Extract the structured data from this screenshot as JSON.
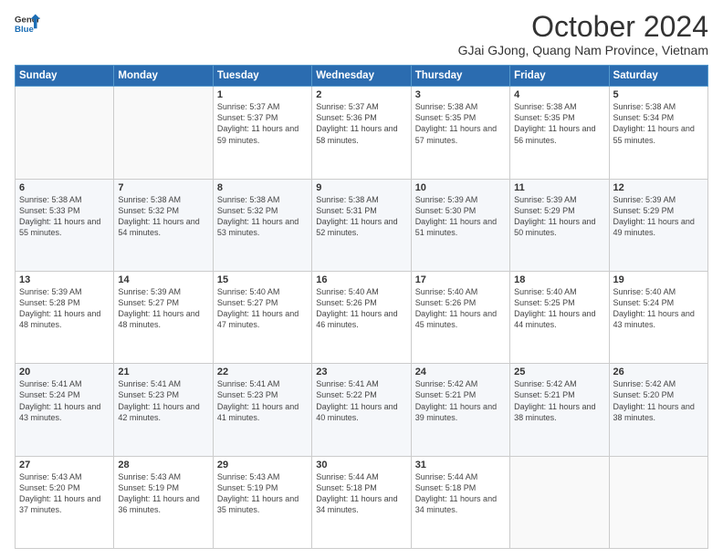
{
  "header": {
    "logo": {
      "line1": "General",
      "line2": "Blue"
    },
    "title": "October 2024",
    "subtitle": "GJai GJong, Quang Nam Province, Vietnam"
  },
  "weekdays": [
    "Sunday",
    "Monday",
    "Tuesday",
    "Wednesday",
    "Thursday",
    "Friday",
    "Saturday"
  ],
  "weeks": [
    [
      {
        "day": "",
        "sunrise": "",
        "sunset": "",
        "daylight": ""
      },
      {
        "day": "",
        "sunrise": "",
        "sunset": "",
        "daylight": ""
      },
      {
        "day": "1",
        "sunrise": "Sunrise: 5:37 AM",
        "sunset": "Sunset: 5:37 PM",
        "daylight": "Daylight: 11 hours and 59 minutes."
      },
      {
        "day": "2",
        "sunrise": "Sunrise: 5:37 AM",
        "sunset": "Sunset: 5:36 PM",
        "daylight": "Daylight: 11 hours and 58 minutes."
      },
      {
        "day": "3",
        "sunrise": "Sunrise: 5:38 AM",
        "sunset": "Sunset: 5:35 PM",
        "daylight": "Daylight: 11 hours and 57 minutes."
      },
      {
        "day": "4",
        "sunrise": "Sunrise: 5:38 AM",
        "sunset": "Sunset: 5:35 PM",
        "daylight": "Daylight: 11 hours and 56 minutes."
      },
      {
        "day": "5",
        "sunrise": "Sunrise: 5:38 AM",
        "sunset": "Sunset: 5:34 PM",
        "daylight": "Daylight: 11 hours and 55 minutes."
      }
    ],
    [
      {
        "day": "6",
        "sunrise": "Sunrise: 5:38 AM",
        "sunset": "Sunset: 5:33 PM",
        "daylight": "Daylight: 11 hours and 55 minutes."
      },
      {
        "day": "7",
        "sunrise": "Sunrise: 5:38 AM",
        "sunset": "Sunset: 5:32 PM",
        "daylight": "Daylight: 11 hours and 54 minutes."
      },
      {
        "day": "8",
        "sunrise": "Sunrise: 5:38 AM",
        "sunset": "Sunset: 5:32 PM",
        "daylight": "Daylight: 11 hours and 53 minutes."
      },
      {
        "day": "9",
        "sunrise": "Sunrise: 5:38 AM",
        "sunset": "Sunset: 5:31 PM",
        "daylight": "Daylight: 11 hours and 52 minutes."
      },
      {
        "day": "10",
        "sunrise": "Sunrise: 5:39 AM",
        "sunset": "Sunset: 5:30 PM",
        "daylight": "Daylight: 11 hours and 51 minutes."
      },
      {
        "day": "11",
        "sunrise": "Sunrise: 5:39 AM",
        "sunset": "Sunset: 5:29 PM",
        "daylight": "Daylight: 11 hours and 50 minutes."
      },
      {
        "day": "12",
        "sunrise": "Sunrise: 5:39 AM",
        "sunset": "Sunset: 5:29 PM",
        "daylight": "Daylight: 11 hours and 49 minutes."
      }
    ],
    [
      {
        "day": "13",
        "sunrise": "Sunrise: 5:39 AM",
        "sunset": "Sunset: 5:28 PM",
        "daylight": "Daylight: 11 hours and 48 minutes."
      },
      {
        "day": "14",
        "sunrise": "Sunrise: 5:39 AM",
        "sunset": "Sunset: 5:27 PM",
        "daylight": "Daylight: 11 hours and 48 minutes."
      },
      {
        "day": "15",
        "sunrise": "Sunrise: 5:40 AM",
        "sunset": "Sunset: 5:27 PM",
        "daylight": "Daylight: 11 hours and 47 minutes."
      },
      {
        "day": "16",
        "sunrise": "Sunrise: 5:40 AM",
        "sunset": "Sunset: 5:26 PM",
        "daylight": "Daylight: 11 hours and 46 minutes."
      },
      {
        "day": "17",
        "sunrise": "Sunrise: 5:40 AM",
        "sunset": "Sunset: 5:26 PM",
        "daylight": "Daylight: 11 hours and 45 minutes."
      },
      {
        "day": "18",
        "sunrise": "Sunrise: 5:40 AM",
        "sunset": "Sunset: 5:25 PM",
        "daylight": "Daylight: 11 hours and 44 minutes."
      },
      {
        "day": "19",
        "sunrise": "Sunrise: 5:40 AM",
        "sunset": "Sunset: 5:24 PM",
        "daylight": "Daylight: 11 hours and 43 minutes."
      }
    ],
    [
      {
        "day": "20",
        "sunrise": "Sunrise: 5:41 AM",
        "sunset": "Sunset: 5:24 PM",
        "daylight": "Daylight: 11 hours and 43 minutes."
      },
      {
        "day": "21",
        "sunrise": "Sunrise: 5:41 AM",
        "sunset": "Sunset: 5:23 PM",
        "daylight": "Daylight: 11 hours and 42 minutes."
      },
      {
        "day": "22",
        "sunrise": "Sunrise: 5:41 AM",
        "sunset": "Sunset: 5:23 PM",
        "daylight": "Daylight: 11 hours and 41 minutes."
      },
      {
        "day": "23",
        "sunrise": "Sunrise: 5:41 AM",
        "sunset": "Sunset: 5:22 PM",
        "daylight": "Daylight: 11 hours and 40 minutes."
      },
      {
        "day": "24",
        "sunrise": "Sunrise: 5:42 AM",
        "sunset": "Sunset: 5:21 PM",
        "daylight": "Daylight: 11 hours and 39 minutes."
      },
      {
        "day": "25",
        "sunrise": "Sunrise: 5:42 AM",
        "sunset": "Sunset: 5:21 PM",
        "daylight": "Daylight: 11 hours and 38 minutes."
      },
      {
        "day": "26",
        "sunrise": "Sunrise: 5:42 AM",
        "sunset": "Sunset: 5:20 PM",
        "daylight": "Daylight: 11 hours and 38 minutes."
      }
    ],
    [
      {
        "day": "27",
        "sunrise": "Sunrise: 5:43 AM",
        "sunset": "Sunset: 5:20 PM",
        "daylight": "Daylight: 11 hours and 37 minutes."
      },
      {
        "day": "28",
        "sunrise": "Sunrise: 5:43 AM",
        "sunset": "Sunset: 5:19 PM",
        "daylight": "Daylight: 11 hours and 36 minutes."
      },
      {
        "day": "29",
        "sunrise": "Sunrise: 5:43 AM",
        "sunset": "Sunset: 5:19 PM",
        "daylight": "Daylight: 11 hours and 35 minutes."
      },
      {
        "day": "30",
        "sunrise": "Sunrise: 5:44 AM",
        "sunset": "Sunset: 5:18 PM",
        "daylight": "Daylight: 11 hours and 34 minutes."
      },
      {
        "day": "31",
        "sunrise": "Sunrise: 5:44 AM",
        "sunset": "Sunset: 5:18 PM",
        "daylight": "Daylight: 11 hours and 34 minutes."
      },
      {
        "day": "",
        "sunrise": "",
        "sunset": "",
        "daylight": ""
      },
      {
        "day": "",
        "sunrise": "",
        "sunset": "",
        "daylight": ""
      }
    ]
  ]
}
